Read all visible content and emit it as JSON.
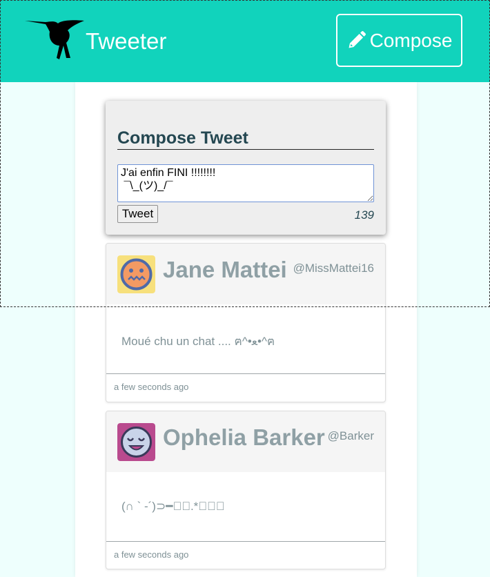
{
  "navbar": {
    "brand": "Tweeter",
    "compose_label": "Compose",
    "logo_icon": "hummingbird-icon",
    "compose_icon": "pencil-icon",
    "background_color": "#11d3bc"
  },
  "compose": {
    "title": "Compose Tweet",
    "text": "J'ai enfin FINI !!!!!!!!\n ¯\\_(ツ)_/¯",
    "submit_label": "Tweet",
    "counter": "139"
  },
  "tweets": [
    {
      "name": "Jane Mattei",
      "handle": "@MissMattei16",
      "body": "Moué chu un chat .... ฅ^•ﻌ•^ฅ",
      "time": "a few seconds ago",
      "avatar_colors": {
        "bg": "#f7e07c",
        "face": "#f39a63",
        "ring": "#4f6aa8"
      }
    },
    {
      "name": "Ophelia Barker",
      "handle": "@Barker",
      "body": "(∩ ` -´)⊃━☆ﾟ.*･｡ﾟ",
      "time": "a few seconds ago",
      "avatar_colors": {
        "bg": "#b94a8e",
        "face": "#c9d3e9",
        "ring": "#3a3a5a"
      }
    }
  ]
}
